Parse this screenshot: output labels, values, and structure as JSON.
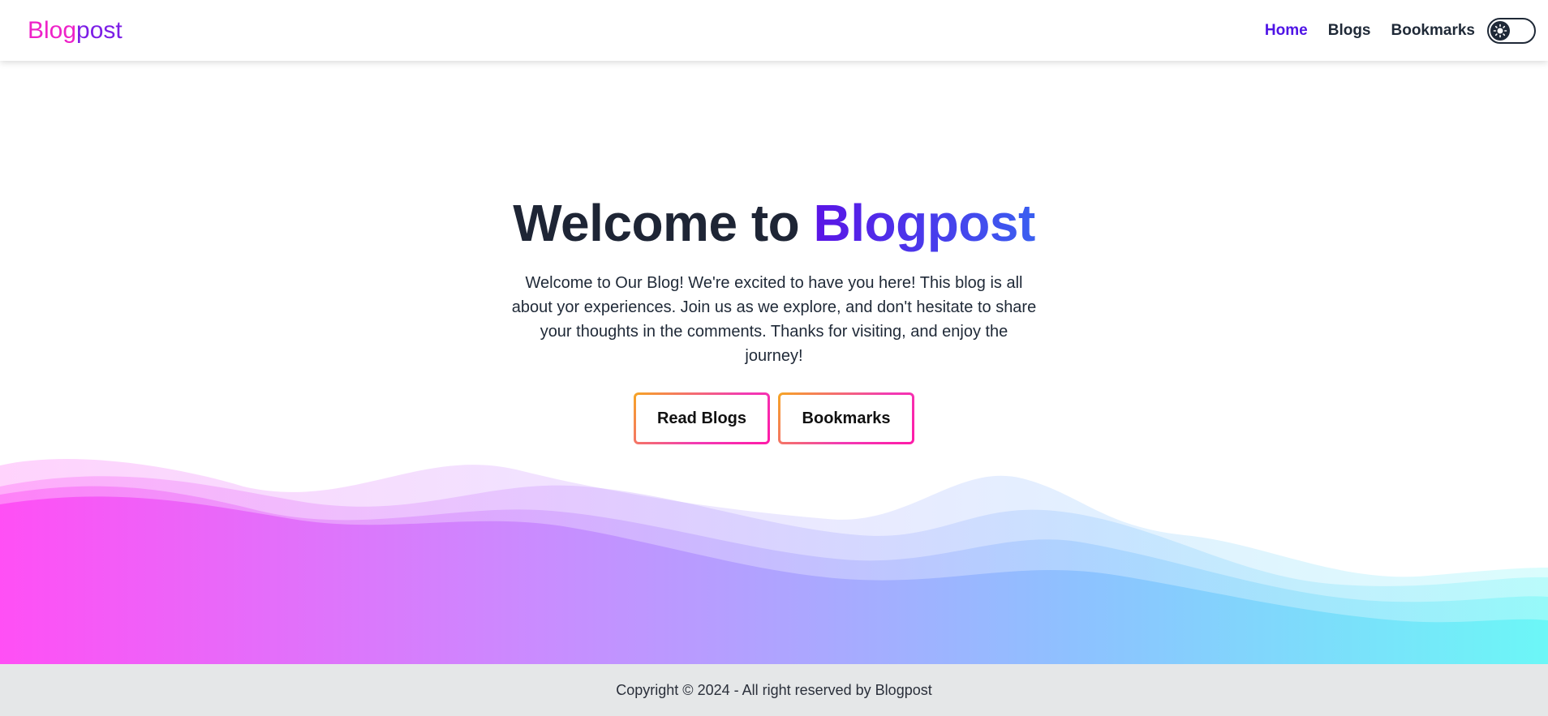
{
  "brand": {
    "logo_part1": "Blog",
    "logo_part2": "post",
    "colors": {
      "pink": "#ee22c8",
      "purple": "#7c1ee6",
      "accent_blue": "#4f14e6"
    }
  },
  "nav": {
    "items": [
      {
        "label": "Home",
        "active": true
      },
      {
        "label": "Blogs",
        "active": false
      },
      {
        "label": "Bookmarks",
        "active": false
      }
    ],
    "theme_toggle_icon": "sun-icon"
  },
  "hero": {
    "title_prefix": "Welcome to ",
    "title_accent": "Blogpost",
    "description": "Welcome to Our Blog! We're excited to have you here! This blog is all about yor experiences. Join us as we explore, and don't hesitate to share your thoughts in the comments. Thanks for visiting, and enjoy the journey!",
    "buttons": [
      {
        "label": "Read Blogs"
      },
      {
        "label": "Bookmarks"
      }
    ]
  },
  "footer": {
    "text": "Copyright © 2024 - All right reserved by Blogpost"
  }
}
